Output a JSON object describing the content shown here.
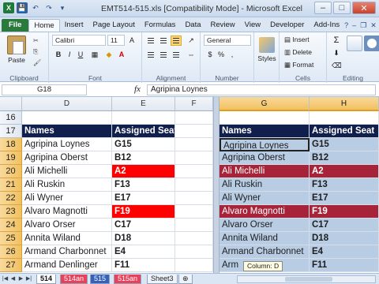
{
  "window": {
    "title": "EMT514-515.xls  [Compatibility Mode]  -  Microsoft Excel",
    "minimize": "–",
    "maximize": "□",
    "close": "✕"
  },
  "quick_access": {
    "logo": "X",
    "save": "💾",
    "undo": "↶",
    "redo": "↷",
    "dropdown": "▾"
  },
  "ribbon_tabs": [
    "File",
    "Home",
    "Insert",
    "Page Layout",
    "Formulas",
    "Data",
    "Review",
    "View",
    "Developer",
    "Add-Ins"
  ],
  "ribbon_tab_active": "Home",
  "ribbon_right": {
    "help": "?",
    "minimize": "–",
    "restore": "❐",
    "close": "✕"
  },
  "ribbon": {
    "clipboard": {
      "paste_label": "Paste",
      "group_label": "Clipboard"
    },
    "font": {
      "font_name": "Calibri",
      "font_size": "11",
      "bold": "B",
      "italic": "I",
      "underline": "U",
      "group_label": "Font"
    },
    "alignment": {
      "group_label": "Alignment"
    },
    "number": {
      "format": "General",
      "currency": "$",
      "percent": "%",
      "comma": ",",
      "group_label": "Number"
    },
    "styles": {
      "label": "Styles"
    },
    "cells": {
      "insert": "Insert",
      "delete": "Delete",
      "format": "Format",
      "group_label": "Cells"
    },
    "editing": {
      "sum": "Σ",
      "sort": "Sort",
      "find": "Find",
      "group_label": "Editing"
    }
  },
  "formula_bar": {
    "name_box": "G18",
    "fx": "fx",
    "formula": "Agripina Loynes"
  },
  "columns": [
    "D",
    "E",
    "F",
    "G",
    "H"
  ],
  "rows": [
    "16",
    "17",
    "18",
    "19",
    "20",
    "21",
    "22",
    "23",
    "24",
    "25",
    "26",
    "27"
  ],
  "table_left": {
    "headers": [
      "Names",
      "Assigned Seat"
    ],
    "data": [
      [
        "Agripina Loynes",
        "G15"
      ],
      [
        "Agripina Oberst",
        "B12"
      ],
      [
        "Ali Michelli",
        "A2"
      ],
      [
        "Ali Ruskin",
        "F13"
      ],
      [
        "Ali Wyner",
        "E17"
      ],
      [
        "Alvaro Magnotti",
        "F19"
      ],
      [
        "Alvaro Orser",
        "C17"
      ],
      [
        "Annita Wiland",
        "D18"
      ],
      [
        "Armand Charbonnet",
        "E4"
      ],
      [
        "Armand Denlinger",
        "F11"
      ]
    ]
  },
  "table_right": {
    "headers": [
      "Names",
      "Assigned Seat"
    ],
    "data": [
      [
        "Agripina Loynes",
        "G15"
      ],
      [
        "Agripina Oberst",
        "B12"
      ],
      [
        "Ali Michelli",
        "A2"
      ],
      [
        "Ali Ruskin",
        "F13"
      ],
      [
        "Ali Wyner",
        "E17"
      ],
      [
        "Alvaro Magnotti",
        "F19"
      ],
      [
        "Alvaro Orser",
        "C17"
      ],
      [
        "Annita Wiland",
        "D18"
      ],
      [
        "Armand Charbonnet",
        "E4"
      ],
      [
        "Arm",
        "F11"
      ]
    ]
  },
  "tooltip": "Column: D",
  "sheet_tabs": [
    "514",
    "514an",
    "515",
    "515an",
    "Sheet3"
  ],
  "active_sheet": "514",
  "colors": {
    "header_bg": "#111f4d",
    "red_highlight": "#ff0000",
    "maroon_highlight": "#a7233a",
    "blue_fill": "#b8cce4",
    "selection_orange": "#f1c15f"
  }
}
